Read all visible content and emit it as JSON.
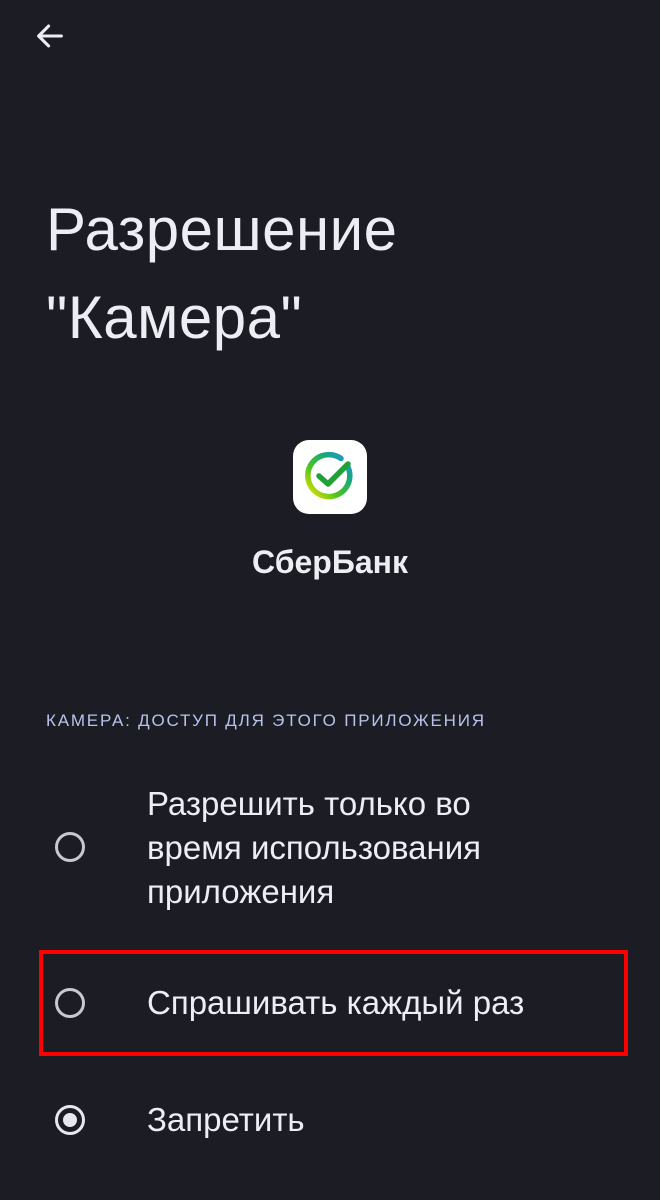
{
  "header": {
    "back_icon": "arrow-left-icon"
  },
  "title": {
    "line1": "Разрешение",
    "line2": "\"Камера\""
  },
  "app": {
    "icon": "sberbank-logo-icon",
    "name": "СберБанк"
  },
  "section": {
    "header": "КАМЕРА: ДОСТУП ДЛЯ ЭТОГО ПРИЛОЖЕНИЯ"
  },
  "options": [
    {
      "label_line1": "Разрешить только во",
      "label_line2": "время использования",
      "label_line3": "приложения",
      "selected": false
    },
    {
      "label": "Спрашивать каждый раз",
      "selected": false,
      "highlighted": true
    },
    {
      "label": "Запретить",
      "selected": true
    }
  ],
  "colors": {
    "background": "#1c1c24",
    "text": "#eceef3",
    "section_header": "#b8c3ea",
    "highlight": "#ff0000"
  }
}
